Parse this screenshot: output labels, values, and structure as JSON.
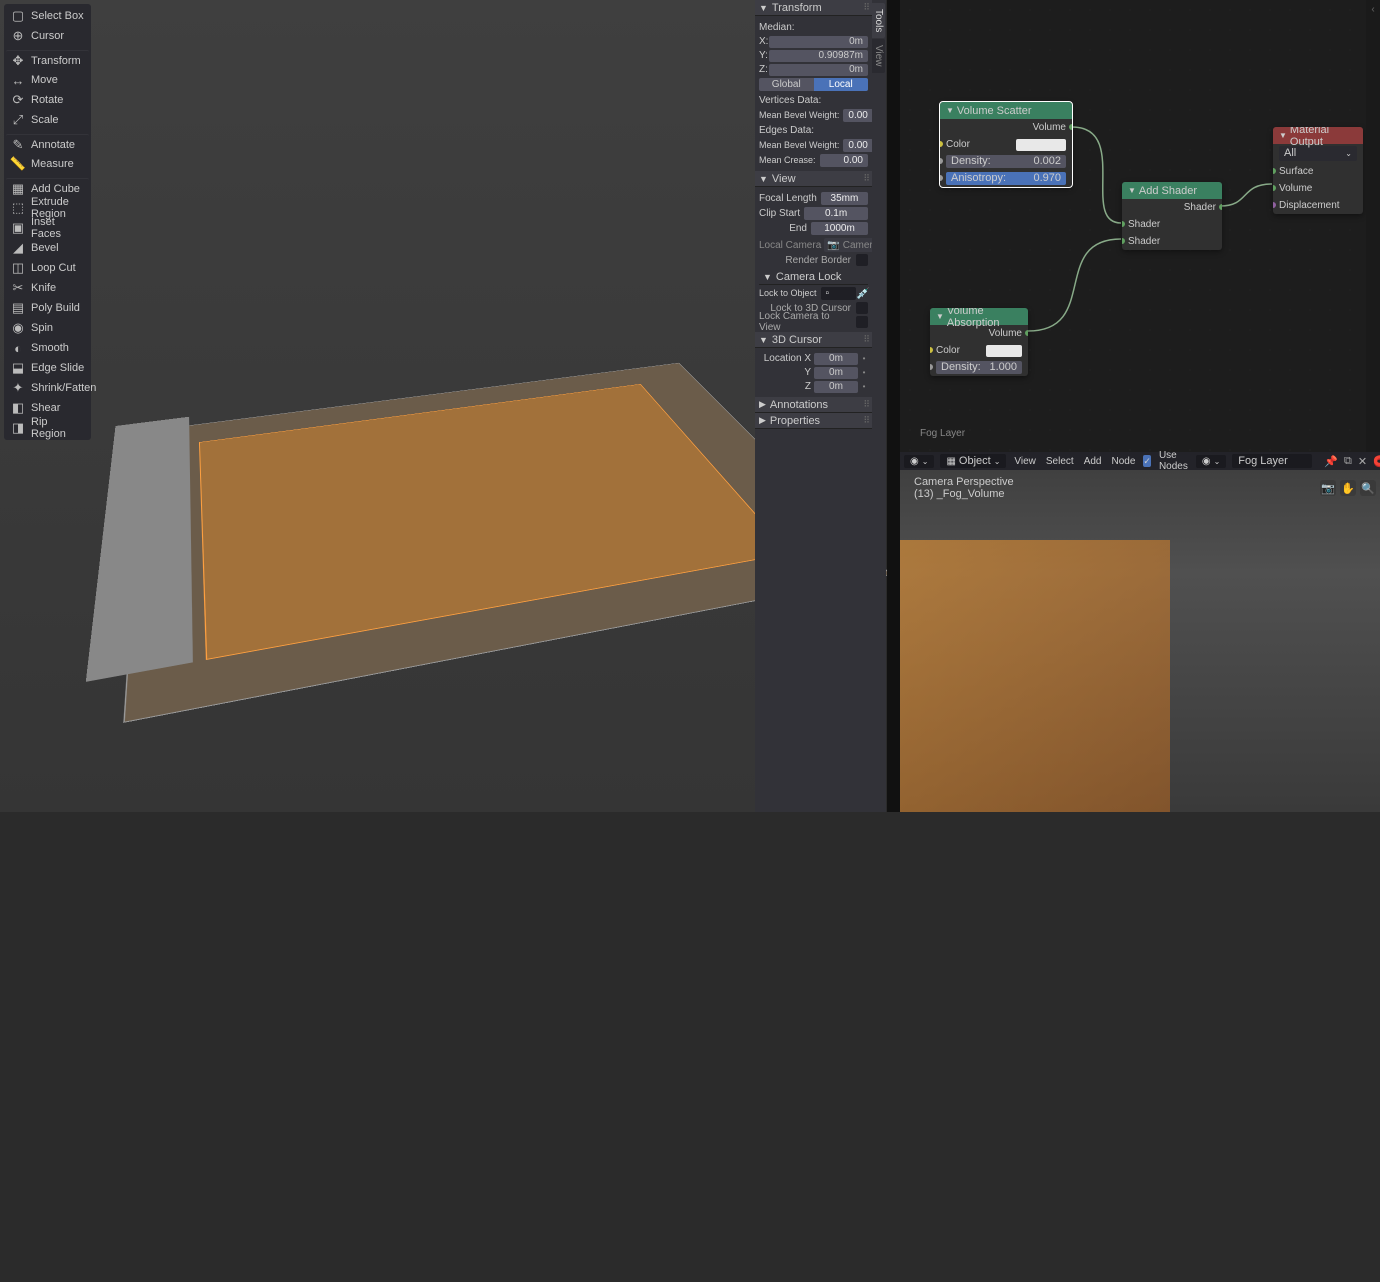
{
  "tools": [
    {
      "icon": "▢",
      "label": "Select Box"
    },
    {
      "icon": "⊕",
      "label": "Cursor"
    },
    {
      "icon": "✥",
      "label": "Transform",
      "sep": true
    },
    {
      "icon": "↔",
      "label": "Move"
    },
    {
      "icon": "⟳",
      "label": "Rotate"
    },
    {
      "icon": "⤢",
      "label": "Scale"
    },
    {
      "icon": "✎",
      "label": "Annotate",
      "sep": true
    },
    {
      "icon": "📏",
      "label": "Measure"
    },
    {
      "icon": "▦",
      "label": "Add Cube",
      "sep": true
    },
    {
      "icon": "⬚",
      "label": "Extrude Region"
    },
    {
      "icon": "▣",
      "label": "Inset Faces"
    },
    {
      "icon": "◢",
      "label": "Bevel"
    },
    {
      "icon": "◫",
      "label": "Loop Cut"
    },
    {
      "icon": "✂",
      "label": "Knife"
    },
    {
      "icon": "▤",
      "label": "Poly Build"
    },
    {
      "icon": "◉",
      "label": "Spin"
    },
    {
      "icon": "◐",
      "label": "Smooth"
    },
    {
      "icon": "⬓",
      "label": "Edge Slide"
    },
    {
      "icon": "✦",
      "label": "Shrink/Fatten"
    },
    {
      "icon": "◧",
      "label": "Shear"
    },
    {
      "icon": "◨",
      "label": "Rip Region"
    }
  ],
  "npanel": {
    "transform": {
      "title": "Transform",
      "median": "Median:",
      "x": "0m",
      "y": "0.90987m",
      "z": "0m",
      "global": "Global",
      "local": "Local",
      "verts": "Vertices Data:",
      "meanBevel": "Mean Bevel Weight:",
      "meanBevelV": "0.00",
      "edges": "Edges Data:",
      "meanBevel2": "Mean Bevel Weight:",
      "meanBevel2V": "0.00",
      "meanCrease": "Mean Crease:",
      "meanCreaseV": "0.00"
    },
    "view": {
      "title": "View",
      "focal": "Focal Length",
      "focalV": "35mm",
      "clipStart": "Clip Start",
      "clipStartV": "0.1m",
      "clipEnd": "End",
      "clipEndV": "1000m",
      "localCam": "Local Camera",
      "camIcon": "📷",
      "camName": "Camera",
      "renderBorder": "Render Border",
      "camLock": "Camera Lock",
      "lockObj": "Lock to Object",
      "lockObjIcon": "▫",
      "eyedrop": "💉",
      "lock3d": "Lock to 3D Cursor",
      "lockCamView": "Lock Camera to View"
    },
    "cursor": {
      "title": "3D Cursor",
      "locX": "Location X",
      "x": "0m",
      "y": "0m",
      "z": "0m"
    },
    "annotations": "Annotations",
    "properties_title": "Properties",
    "tabs": [
      "Tools",
      "View"
    ]
  },
  "nodes": {
    "scatter": {
      "title": "Volume Scatter",
      "out": "Volume",
      "color": "Color",
      "density": "Density:",
      "densityV": "0.002",
      "aniso": "Anisotropy:",
      "anisoV": "0.970"
    },
    "add": {
      "title": "Add Shader",
      "out": "Shader",
      "in1": "Shader",
      "in2": "Shader"
    },
    "absorb": {
      "title": "Volume Absorption",
      "out": "Volume",
      "color": "Color",
      "density": "Density:",
      "densityV": "1.000"
    },
    "matout": {
      "title": "Material Output",
      "sel": "All",
      "surface": "Surface",
      "volume": "Volume",
      "disp": "Displacement"
    },
    "bottomLabel": "Fog Layer"
  },
  "neHeader": {
    "mode": "Object",
    "menus": [
      "View",
      "Select",
      "Add",
      "Node"
    ],
    "useNodes": "Use Nodes",
    "slot": "Fog Layer"
  },
  "preview": {
    "line1": "Camera Perspective",
    "line2": "(13) _Fog_Volume"
  }
}
